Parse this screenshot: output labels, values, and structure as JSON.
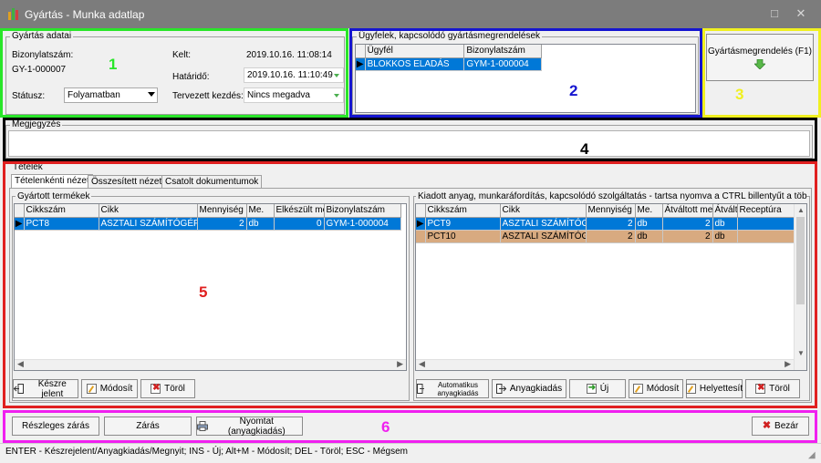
{
  "window": {
    "title": "Gyártás - Munka adatlap",
    "minimize": "□",
    "close": "✕"
  },
  "production": {
    "legend": "Gyártás adatai",
    "doc_label": "Bizonylatszám:",
    "doc_value": "GY-1-000007",
    "status_label": "Státusz:",
    "status_value": "Folyamatban",
    "date_label": "Kelt:",
    "date_value": "2019.10.16. 11:08:14",
    "deadline_label": "Határidő:",
    "deadline_value": "2019.10.16. 11:10:49",
    "planned_label": "Tervezett kezdés:",
    "planned_value": "Nincs megadva"
  },
  "customers": {
    "legend": "Ügyfelek, kapcsolódó gyártásmegrendelések",
    "columns": [
      "Ügyfél",
      "Bizonylatszám"
    ],
    "rows": [
      [
        "BLOKKOS ELADÁS",
        "GYM-1-000004"
      ]
    ]
  },
  "order_button": {
    "label": "Gyártásmegrendelés (F1)"
  },
  "notes": {
    "legend": "Megjegyzés",
    "value": ""
  },
  "items": {
    "legend": "Tételek",
    "tabs": [
      "Tételenkénti nézet",
      "Összesített nézet",
      "Csatolt dokumentumok"
    ],
    "produced": {
      "legend": "Gyártott termékek",
      "columns": [
        "Cikkszám",
        "Cikk",
        "Mennyiség",
        "Me.",
        "Elkészült mer",
        "Bizonylatszám"
      ],
      "rows": [
        [
          "PCT8",
          "ASZTALI SZÁMÍTÓGÉP (GY",
          "2",
          "db",
          "0",
          "GYM-1-000004"
        ]
      ],
      "buttons": [
        "Készre jelent",
        "Módosít",
        "Töröl"
      ]
    },
    "issued": {
      "legend": "Kiadott anyag, munkaráfordítás, kapcsolódó szolgáltatás - tartsa nyomva a CTRL billentyűt a többszörös k",
      "columns": [
        "Cikkszám",
        "Cikk",
        "Mennyiség",
        "Me.",
        "Átváltott mer",
        "Átvált",
        "Receptúra"
      ],
      "rows": [
        [
          "PCT9",
          "ASZTALI SZÁMÍTÓGÉP ALA",
          "2",
          "db",
          "2",
          "db",
          ""
        ],
        [
          "PCT10",
          "ASZTALI SZÁMÍTÓGÉP ALA",
          "2",
          "db",
          "2",
          "db",
          ""
        ]
      ],
      "buttons": [
        "Automatikus anyagkiadás",
        "Anyagkiadás",
        "Új",
        "Módosít",
        "Helyettesít",
        "Töröl"
      ]
    }
  },
  "footer": {
    "partial_close": "Részleges zárás",
    "close": "Zárás",
    "print": "Nyomtat (anyagkiadás)",
    "exit": "Bezár"
  },
  "statusbar": "ENTER - Készrejelent/Anyagkiadás/Megnyit; INS - Új; Alt+M - Módosít; DEL - Töröl; ESC - Mégsem",
  "annotations": [
    "1",
    "2",
    "3",
    "4",
    "5",
    "6"
  ],
  "colors": {
    "green": "#29e629",
    "blue": "#1515d0",
    "yellow": "#f0f020",
    "black": "#000000",
    "red": "#e02020",
    "magenta": "#f020f0"
  }
}
